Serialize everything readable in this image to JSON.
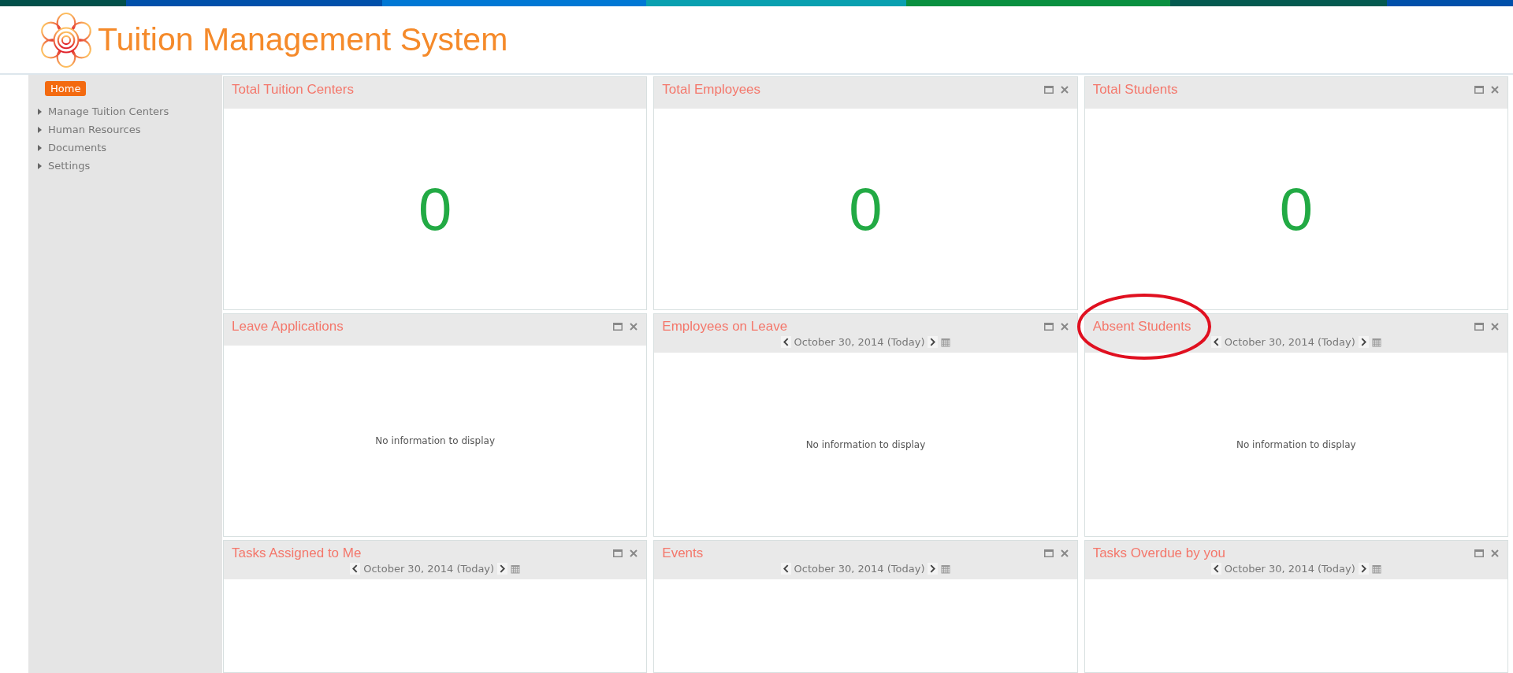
{
  "app_title": "Tuition Management System",
  "sidebar": {
    "items": [
      {
        "label": "Home",
        "selected": true
      },
      {
        "label": "Manage Tuition Centers",
        "selected": false
      },
      {
        "label": "Human Resources",
        "selected": false
      },
      {
        "label": "Documents",
        "selected": false
      },
      {
        "label": "Settings",
        "selected": false
      }
    ]
  },
  "widgets": [
    {
      "kind": "count",
      "title": "Total Tuition Centers",
      "controls": false,
      "value": "0"
    },
    {
      "kind": "count",
      "title": "Total Employees",
      "controls": true,
      "value": "0"
    },
    {
      "kind": "count",
      "title": "Total Students",
      "controls": true,
      "value": "0"
    },
    {
      "kind": "list",
      "title": "Leave Applications",
      "controls": true,
      "message": "No information to display"
    },
    {
      "kind": "list",
      "title": "Employees on Leave",
      "controls": true,
      "date": "October 30, 2014 (Today)",
      "message": "No information to display"
    },
    {
      "kind": "list",
      "title": "Absent Students",
      "controls": true,
      "date": "October 30, 2014 (Today)",
      "message": "No information to display"
    },
    {
      "kind": "list",
      "title": "Tasks Assigned to Me",
      "controls": true,
      "date": "October 30, 2014 (Today)"
    },
    {
      "kind": "list",
      "title": "Events",
      "controls": true,
      "date": "October 30, 2014 (Today)"
    },
    {
      "kind": "list",
      "title": "Tasks Overdue by you",
      "controls": true,
      "date": "October 30, 2014 (Today)"
    }
  ]
}
